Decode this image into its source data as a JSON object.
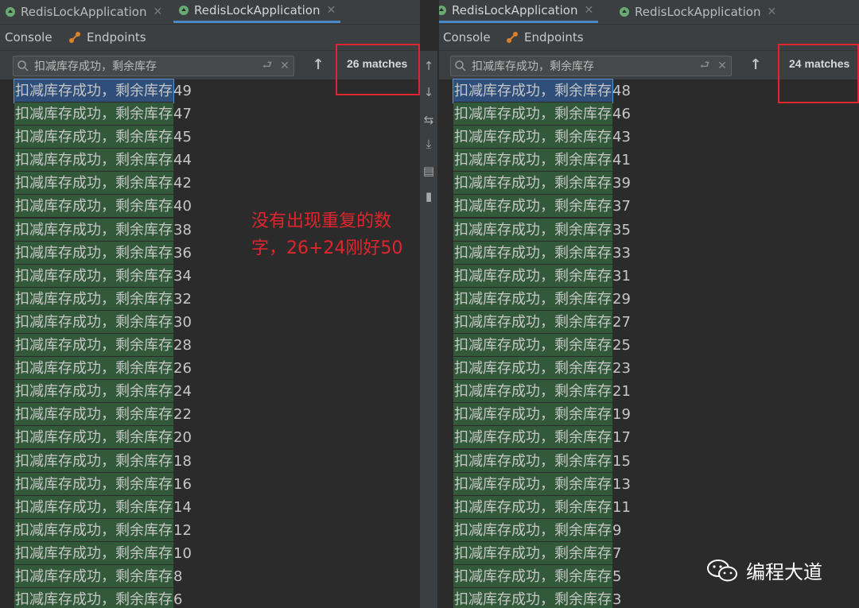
{
  "left": {
    "tabs": [
      {
        "label": "RedisLockApplication",
        "active": false
      },
      {
        "label": "RedisLockApplication",
        "active": true
      }
    ],
    "tool_tabs": [
      "Console",
      "Endpoints"
    ],
    "search_query": "扣减库存成功，剩余库存",
    "match_count": "26 matches",
    "lines": [
      {
        "prefix": "扣减库存成功，剩余库存",
        "value": "49"
      },
      {
        "prefix": "扣减库存成功，剩余库存",
        "value": "47"
      },
      {
        "prefix": "扣减库存成功，剩余库存",
        "value": "45"
      },
      {
        "prefix": "扣减库存成功，剩余库存",
        "value": "44"
      },
      {
        "prefix": "扣减库存成功，剩余库存",
        "value": "42"
      },
      {
        "prefix": "扣减库存成功，剩余库存",
        "value": "40"
      },
      {
        "prefix": "扣减库存成功，剩余库存",
        "value": "38"
      },
      {
        "prefix": "扣减库存成功，剩余库存",
        "value": "36"
      },
      {
        "prefix": "扣减库存成功，剩余库存",
        "value": "34"
      },
      {
        "prefix": "扣减库存成功，剩余库存",
        "value": "32"
      },
      {
        "prefix": "扣减库存成功，剩余库存",
        "value": "30"
      },
      {
        "prefix": "扣减库存成功，剩余库存",
        "value": "28"
      },
      {
        "prefix": "扣减库存成功，剩余库存",
        "value": "26"
      },
      {
        "prefix": "扣减库存成功，剩余库存",
        "value": "24"
      },
      {
        "prefix": "扣减库存成功，剩余库存",
        "value": "22"
      },
      {
        "prefix": "扣减库存成功，剩余库存",
        "value": "20"
      },
      {
        "prefix": "扣减库存成功，剩余库存",
        "value": "18"
      },
      {
        "prefix": "扣减库存成功，剩余库存",
        "value": "16"
      },
      {
        "prefix": "扣减库存成功，剩余库存",
        "value": "14"
      },
      {
        "prefix": "扣减库存成功，剩余库存",
        "value": "12"
      },
      {
        "prefix": "扣减库存成功，剩余库存",
        "value": "10"
      },
      {
        "prefix": "扣减库存成功，剩余库存",
        "value": "8"
      },
      {
        "prefix": "扣减库存成功，剩余库存",
        "value": "6"
      }
    ]
  },
  "right": {
    "tabs": [
      {
        "label": "RedisLockApplication",
        "active": true
      },
      {
        "label": "RedisLockApplication",
        "active": false
      }
    ],
    "tool_tabs": [
      "Console",
      "Endpoints"
    ],
    "search_query": "扣减库存成功，剩余库存",
    "match_count": "24 matches",
    "lines": [
      {
        "prefix": "扣减库存成功，剩余库存",
        "value": "48"
      },
      {
        "prefix": "扣减库存成功，剩余库存",
        "value": "46"
      },
      {
        "prefix": "扣减库存成功，剩余库存",
        "value": "43"
      },
      {
        "prefix": "扣减库存成功，剩余库存",
        "value": "41"
      },
      {
        "prefix": "扣减库存成功，剩余库存",
        "value": "39"
      },
      {
        "prefix": "扣减库存成功，剩余库存",
        "value": "37"
      },
      {
        "prefix": "扣减库存成功，剩余库存",
        "value": "35"
      },
      {
        "prefix": "扣减库存成功，剩余库存",
        "value": "33"
      },
      {
        "prefix": "扣减库存成功，剩余库存",
        "value": "31"
      },
      {
        "prefix": "扣减库存成功，剩余库存",
        "value": "29"
      },
      {
        "prefix": "扣减库存成功，剩余库存",
        "value": "27"
      },
      {
        "prefix": "扣减库存成功，剩余库存",
        "value": "25"
      },
      {
        "prefix": "扣减库存成功，剩余库存",
        "value": "23"
      },
      {
        "prefix": "扣减库存成功，剩余库存",
        "value": "21"
      },
      {
        "prefix": "扣减库存成功，剩余库存",
        "value": "19"
      },
      {
        "prefix": "扣减库存成功，剩余库存",
        "value": "17"
      },
      {
        "prefix": "扣减库存成功，剩余库存",
        "value": "15"
      },
      {
        "prefix": "扣减库存成功，剩余库存",
        "value": "13"
      },
      {
        "prefix": "扣减库存成功，剩余库存",
        "value": "11"
      },
      {
        "prefix": "扣减库存成功，剩余库存",
        "value": "9"
      },
      {
        "prefix": "扣减库存成功，剩余库存",
        "value": "7"
      },
      {
        "prefix": "扣减库存成功，剩余库存",
        "value": "5"
      },
      {
        "prefix": "扣减库存成功，剩余库存",
        "value": "3"
      }
    ]
  },
  "annotation": "没有出现重复的数字，26+24刚好50",
  "watermark": "编程大道",
  "colors": {
    "match_highlight": "#325a3a",
    "current_match": "#2f4f7a",
    "annotation_red": "#e0252d",
    "active_tab_underline": "#4a88c7"
  },
  "icons": {
    "run_tab": "spring-boot-icon",
    "console": "console-icon",
    "endpoints": "endpoints-icon",
    "search": "search-icon",
    "regex": "regex-icon",
    "clear": "close-icon",
    "prev_match": "up-arrow-icon"
  }
}
